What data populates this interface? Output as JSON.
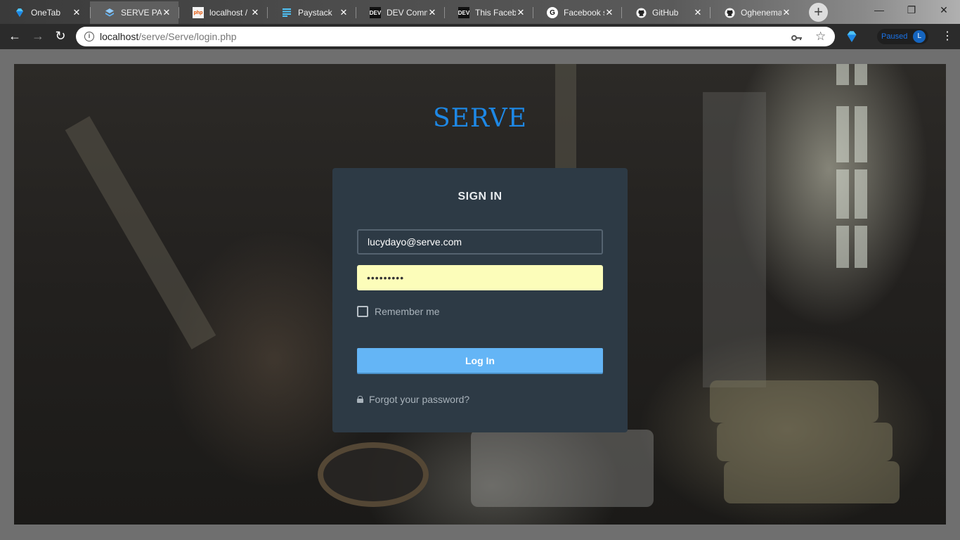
{
  "browser": {
    "tabs": [
      {
        "label": "OneTab",
        "icon": "gem-icon",
        "active": false
      },
      {
        "label": "SERVE PAYR",
        "icon": "layers-icon",
        "active": true
      },
      {
        "label": "localhost / r",
        "icon": "phpmyadmin-icon",
        "active": false
      },
      {
        "label": "Paystack",
        "icon": "paystack-icon",
        "active": false
      },
      {
        "label": "DEV Comm",
        "icon": "dev-icon",
        "active": false
      },
      {
        "label": "This Facebo",
        "icon": "dev-icon",
        "active": false
      },
      {
        "label": "Facebook s",
        "icon": "g-icon",
        "active": false
      },
      {
        "label": "GitHub",
        "icon": "github-icon",
        "active": false
      },
      {
        "label": "Oghenema",
        "icon": "github-icon",
        "active": false
      }
    ],
    "close_glyph": "✕",
    "new_tab_glyph": "+",
    "window_controls": {
      "minimize": "—",
      "restore": "❐",
      "close": "✕"
    },
    "nav": {
      "back": "←",
      "forward": "→",
      "reload": "↻"
    },
    "url": {
      "host": "localhost",
      "path": "/serve/Serve/login.php"
    },
    "profile": {
      "status": "Paused",
      "initial": "L"
    },
    "colors": {
      "accent": "#1a73e8"
    }
  },
  "login": {
    "brand": "SERVE",
    "title": "SIGN IN",
    "email_value": "lucydayo@serve.com",
    "password_value": "•••••••••",
    "remember_label": "Remember me",
    "remember_checked": false,
    "login_button": "Log In",
    "forgot_link": "Forgot your password?"
  },
  "colors": {
    "brand": "#1e88e5",
    "card_bg": "#2d3a45",
    "button": "#64b5f6",
    "autofill": "#fcfdba"
  }
}
